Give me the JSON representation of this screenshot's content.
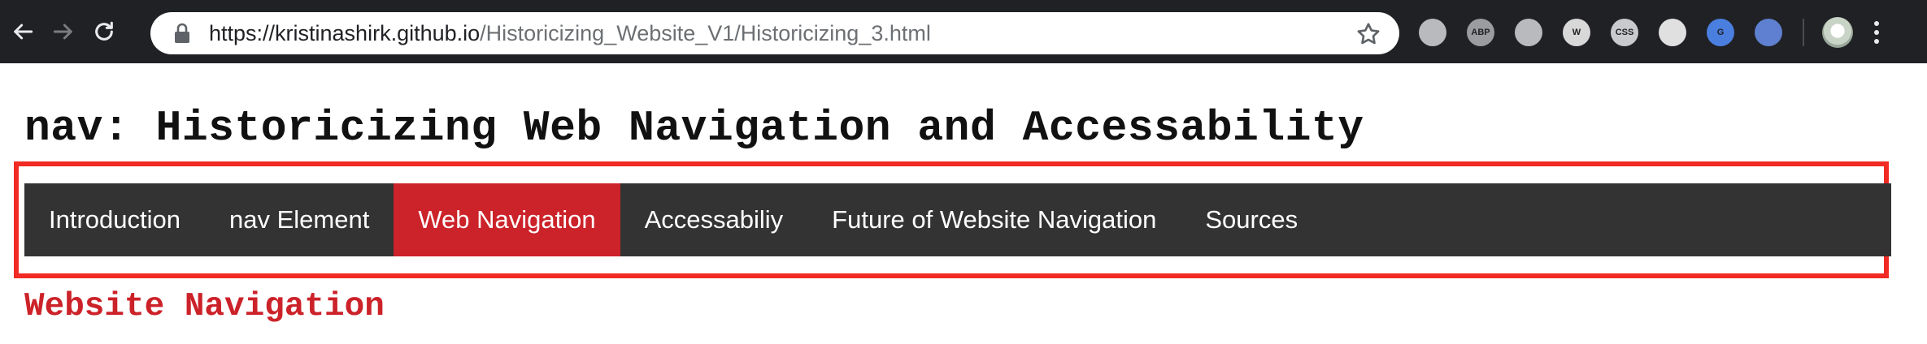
{
  "browser": {
    "url_host": "https://kristinashirk.github.io",
    "url_path": "/Historicizing_Website_V1/Historicizing_3.html",
    "icons": {
      "back": "back-arrow-icon",
      "forward": "forward-arrow-icon",
      "reload": "reload-icon",
      "lock": "lock-icon",
      "bookmark": "star-icon"
    },
    "extensions": [
      {
        "name": "google-drive-icon",
        "label": "",
        "color": "#b8babd"
      },
      {
        "name": "adblock-plus-icon",
        "label": "ABP",
        "color": "#9a9c9f"
      },
      {
        "name": "hat-extension-icon",
        "label": "",
        "color": "#b8babd"
      },
      {
        "name": "wikiwand-icon",
        "label": "W",
        "color": "#d8d8d8"
      },
      {
        "name": "css-viewer-icon",
        "label": "CSS",
        "color": "#c8cacd"
      },
      {
        "name": "circle-extension-icon",
        "label": "",
        "color": "#e0e0e0"
      },
      {
        "name": "google-translate-icon",
        "label": "G",
        "color": "#4a7fe0"
      },
      {
        "name": "blocked-extension-icon",
        "label": "",
        "color": "#5f7fd0"
      }
    ]
  },
  "page": {
    "title": "nav: Historicizing Web Navigation and Accessability",
    "nav_items": [
      {
        "label": "Introduction",
        "active": false
      },
      {
        "label": "nav Element",
        "active": false
      },
      {
        "label": "Web Navigation",
        "active": true
      },
      {
        "label": "Accessabiliy",
        "active": false
      },
      {
        "label": "Future of Website Navigation",
        "active": false
      },
      {
        "label": "Sources",
        "active": false
      }
    ],
    "section_heading": "Website Navigation"
  },
  "colors": {
    "nav_background": "#333333",
    "nav_active": "#cc2229",
    "highlight_border": "#f12a24",
    "heading_red": "#cc2229"
  }
}
